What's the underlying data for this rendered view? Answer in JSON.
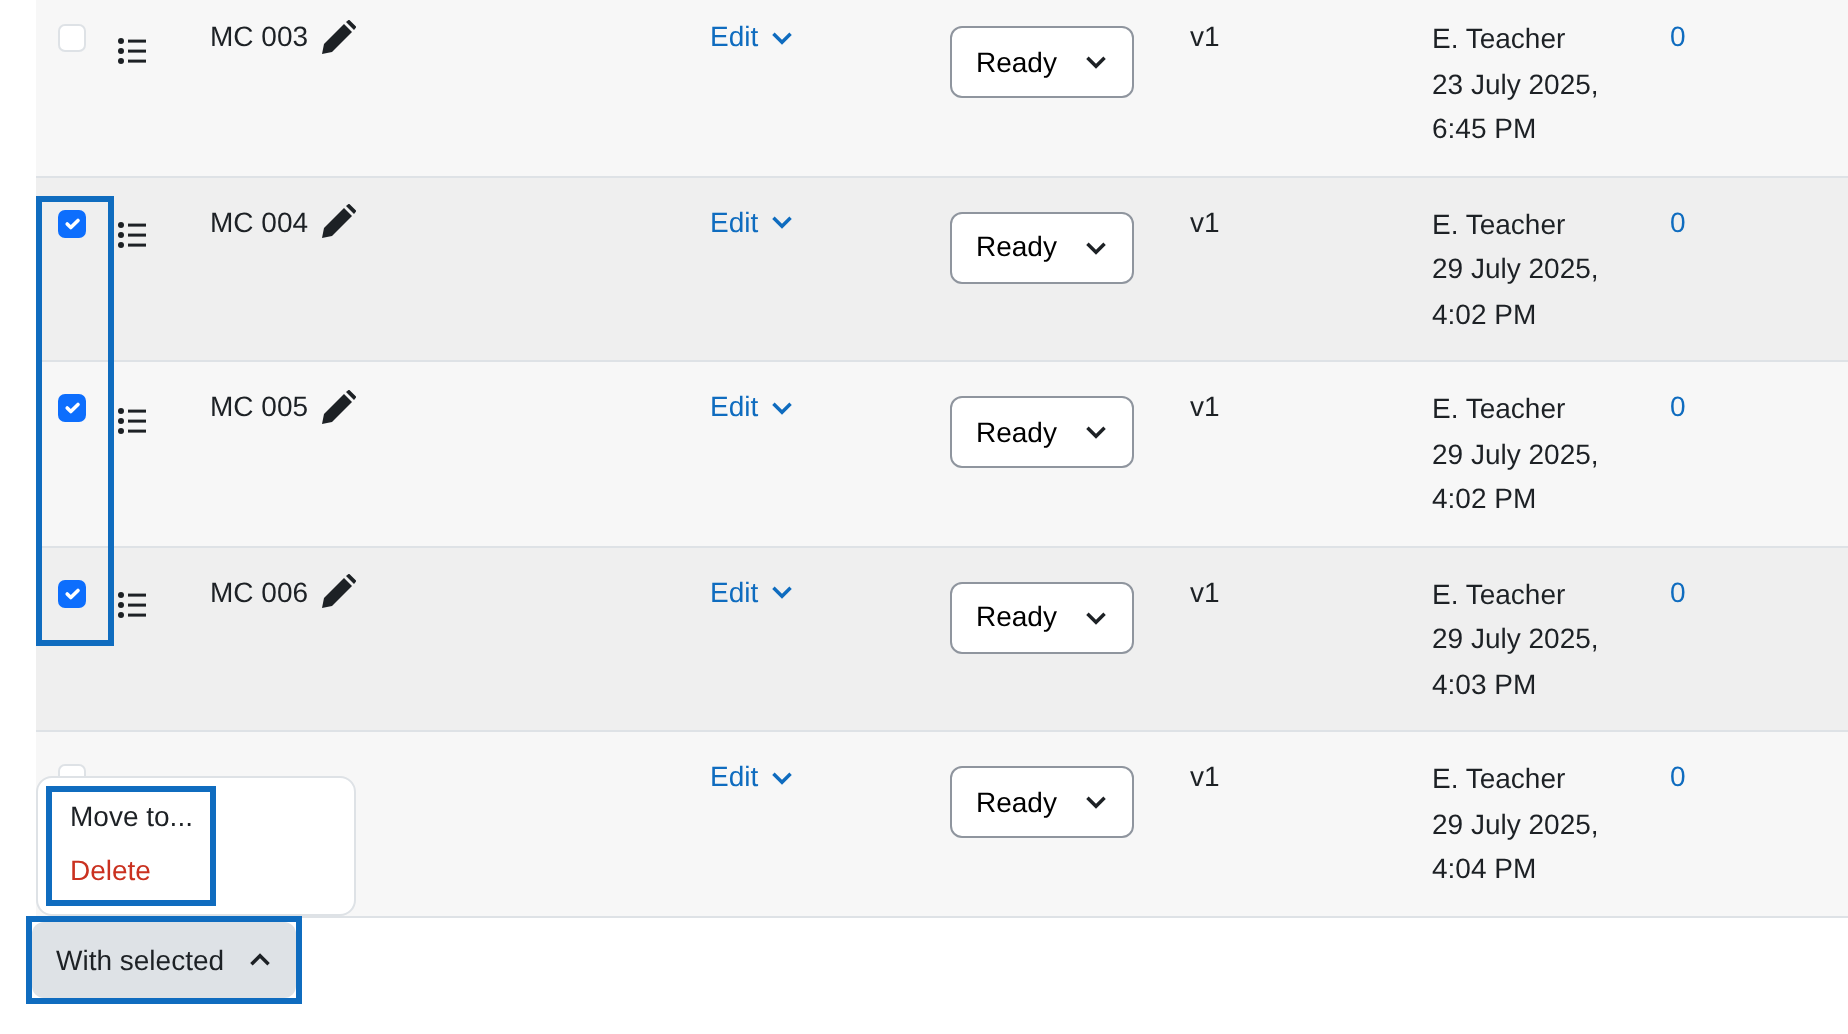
{
  "rows": [
    {
      "checked": false,
      "name": "MC 003",
      "action": "Edit",
      "status": "Ready",
      "version": "v1",
      "author": "E. Teacher",
      "date": "23 July 2025,",
      "time": "6:45 PM",
      "count": "0"
    },
    {
      "checked": true,
      "name": "MC 004",
      "action": "Edit",
      "status": "Ready",
      "version": "v1",
      "author": "E. Teacher",
      "date": "29 July 2025,",
      "time": "4:02 PM",
      "count": "0"
    },
    {
      "checked": true,
      "name": "MC 005",
      "action": "Edit",
      "status": "Ready",
      "version": "v1",
      "author": "E. Teacher",
      "date": "29 July 2025,",
      "time": "4:02 PM",
      "count": "0"
    },
    {
      "checked": true,
      "name": "MC 006",
      "action": "Edit",
      "status": "Ready",
      "version": "v1",
      "author": "E. Teacher",
      "date": "29 July 2025,",
      "time": "4:03 PM",
      "count": "0"
    },
    {
      "checked": false,
      "action": "Edit",
      "status": "Ready",
      "version": "v1",
      "author": "E. Teacher",
      "date": "29 July 2025,",
      "time": "4:04 PM",
      "count": "0"
    }
  ],
  "checked_rows_highlighted": true,
  "menu": {
    "highlighted": true,
    "items": [
      {
        "label": "Move to...",
        "kind": "normal"
      },
      {
        "label": "Delete",
        "kind": "danger"
      }
    ]
  },
  "with_selected_button": {
    "label": "With selected",
    "highlighted": true
  }
}
